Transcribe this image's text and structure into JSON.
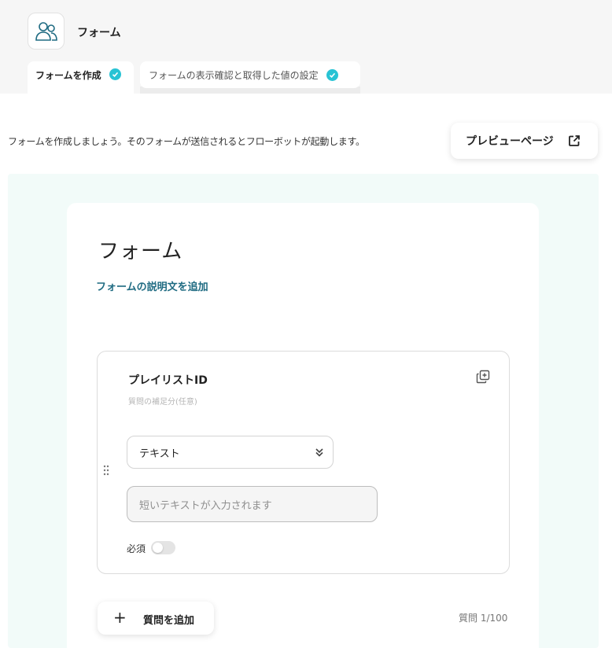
{
  "header": {
    "app_title": "フォーム",
    "app_icon": "users-icon"
  },
  "tabs": [
    {
      "label": "フォームを作成",
      "completed": true
    },
    {
      "label": "フォームの表示確認と取得した値の設定",
      "completed": true
    }
  ],
  "intro_text": "フォームを作成しましょう。そのフォームが送信されるとフローボットが起動します。",
  "preview_button": {
    "label": "プレビューページ"
  },
  "form": {
    "title": "フォーム",
    "add_description": "フォームの説明文を追加"
  },
  "question": {
    "title": "プレイリストID",
    "subtitle": "質問の補足分(任意)",
    "type": "テキスト",
    "answer_placeholder": "短いテキストが入力されます",
    "required_label": "必須",
    "required": false
  },
  "footer": {
    "add_question": "質問を追加",
    "question_count": "質問 1/100"
  },
  "colors": {
    "accent": "#28c3d4",
    "link": "#1f6b82",
    "canvas_bg": "#f2fbf9"
  }
}
